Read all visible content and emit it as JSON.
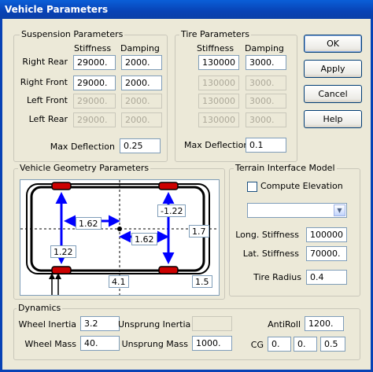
{
  "window": {
    "title": "Vehicle Parameters"
  },
  "suspension": {
    "group_label": "Suspension Parameters",
    "col_stiffness": "Stiffness",
    "col_damping": "Damping",
    "rows": [
      {
        "label": "Right Rear",
        "stiffness": "29000.",
        "damping": "2000.",
        "enabled": true
      },
      {
        "label": "Right Front",
        "stiffness": "29000.",
        "damping": "2000.",
        "enabled": true
      },
      {
        "label": "Left Front",
        "stiffness": "29000.",
        "damping": "2000.",
        "enabled": false
      },
      {
        "label": "Left Rear",
        "stiffness": "29000.",
        "damping": "2000.",
        "enabled": false
      }
    ],
    "max_deflection_label": "Max Deflection",
    "max_deflection": "0.25"
  },
  "tire": {
    "group_label": "Tire Parameters",
    "col_stiffness": "Stiffness",
    "col_damping": "Damping",
    "rows": [
      {
        "stiffness": "130000",
        "damping": "3000.",
        "enabled": true
      },
      {
        "stiffness": "130000",
        "damping": "3000.",
        "enabled": false
      },
      {
        "stiffness": "130000",
        "damping": "3000.",
        "enabled": false
      },
      {
        "stiffness": "130000",
        "damping": "3000.",
        "enabled": false
      }
    ],
    "max_deflection_label": "Max Deflection",
    "max_deflection": "0.1"
  },
  "buttons": {
    "ok": "OK",
    "apply": "Apply",
    "cancel": "Cancel",
    "help": "Help"
  },
  "geometry": {
    "group_label": "Vehicle Geometry Parameters",
    "front_offset": "1.62",
    "rear_offset": "1.62",
    "right_offset": "-1.22",
    "left_offset": "1.22",
    "track_width": "1.7",
    "wheelbase": "4.1",
    "height": "1.5"
  },
  "terrain": {
    "group_label": "Terrain Interface Model",
    "compute_elevation_label": "Compute Elevation",
    "compute_elevation": false,
    "dropdown_value": "",
    "long_stiffness_label": "Long. Stiffness",
    "long_stiffness": "100000",
    "lat_stiffness_label": "Lat. Stiffness",
    "lat_stiffness": "70000.",
    "tire_radius_label": "Tire Radius",
    "tire_radius": "0.4"
  },
  "dynamics": {
    "group_label": "Dynamics",
    "wheel_inertia_label": "Wheel Inertia",
    "wheel_inertia": "3.2",
    "wheel_mass_label": "Wheel Mass",
    "wheel_mass": "40.",
    "unsprung_inertia_label": "Unsprung Inertia",
    "unsprung_inertia": "",
    "unsprung_mass_label": "Unsprung Mass",
    "unsprung_mass": "1000.",
    "antiroll_label": "AntiRoll",
    "antiroll": "1200.",
    "cg_label": "CG",
    "cg_x": "0.",
    "cg_y": "0.",
    "cg_z": "0.5"
  },
  "colors": {
    "arrow": "#0000ff",
    "wheel": "#cc0000",
    "title_bar": "#0842b5"
  }
}
